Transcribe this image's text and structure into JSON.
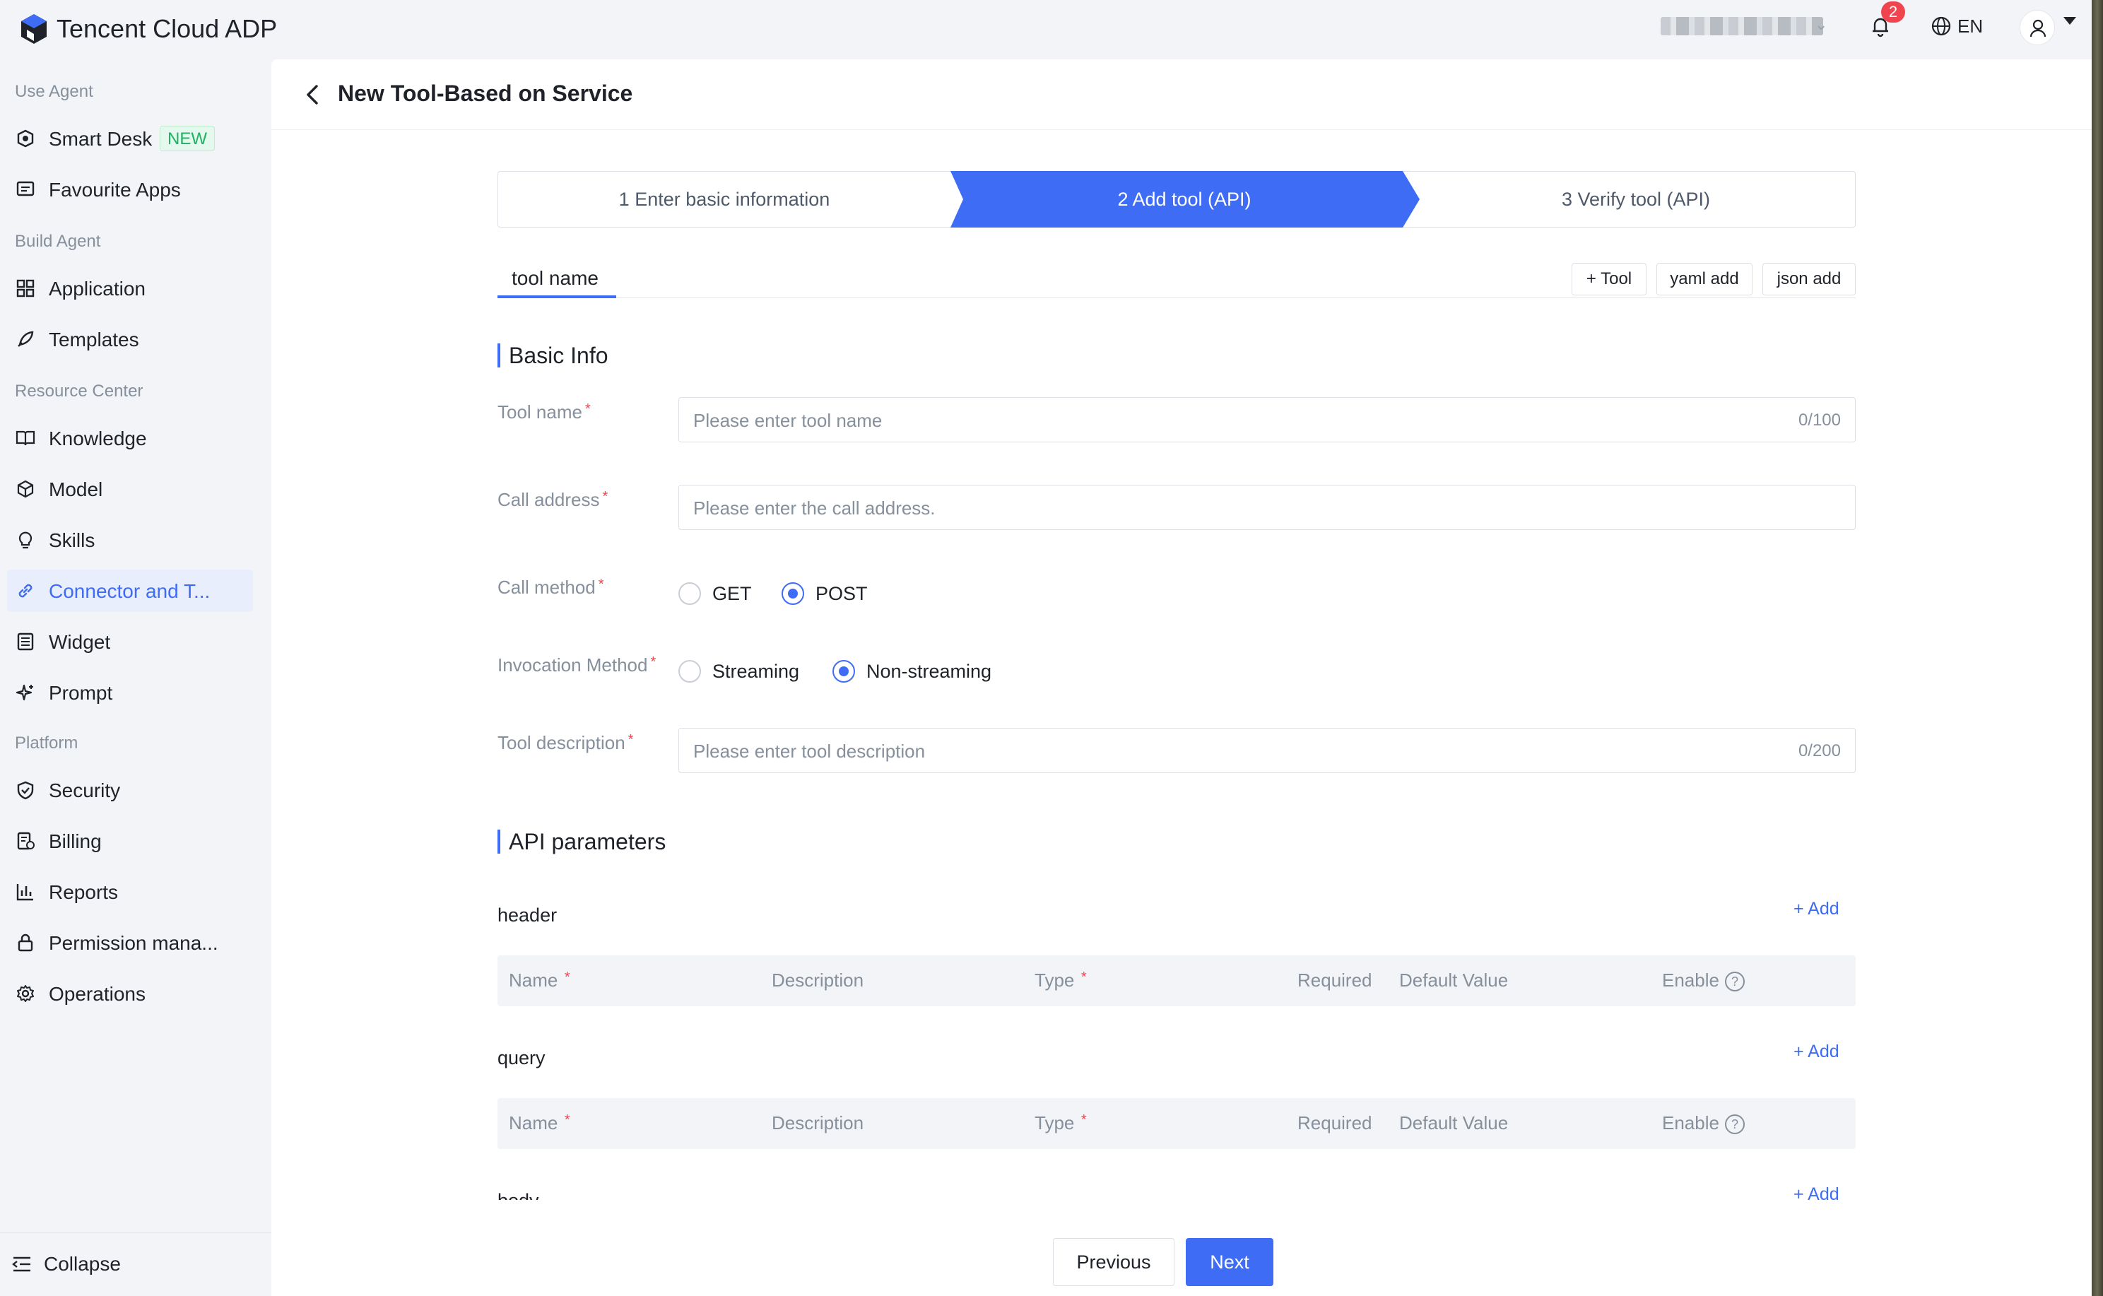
{
  "app": {
    "brand": "Tencent Cloud ADP",
    "notifications": "2",
    "lang": "EN"
  },
  "sidebar": {
    "sections": [
      {
        "title": "Use Agent"
      },
      {
        "title": "Build Agent"
      },
      {
        "title": "Resource Center"
      },
      {
        "title": "Platform"
      }
    ],
    "items": [
      {
        "label": "Smart Desk",
        "badge": "NEW",
        "icon": "smart-desk-icon"
      },
      {
        "label": "Favourite Apps",
        "icon": "favourite-icon"
      },
      {
        "label": "Application",
        "icon": "grid-icon"
      },
      {
        "label": "Templates",
        "icon": "rocket-icon"
      },
      {
        "label": "Knowledge",
        "icon": "book-icon"
      },
      {
        "label": "Model",
        "icon": "cube-icon"
      },
      {
        "label": "Skills",
        "icon": "bulb-icon"
      },
      {
        "label": "Connector and T...",
        "icon": "link-icon",
        "active": true
      },
      {
        "label": "Widget",
        "icon": "widget-icon"
      },
      {
        "label": "Prompt",
        "icon": "sparkle-icon"
      },
      {
        "label": "Security",
        "icon": "shield-icon"
      },
      {
        "label": "Billing",
        "icon": "bill-icon"
      },
      {
        "label": "Reports",
        "icon": "bar-chart-icon"
      },
      {
        "label": "Permission mana...",
        "icon": "lock-icon"
      },
      {
        "label": "Operations",
        "icon": "gear-icon"
      }
    ],
    "collapse": "Collapse"
  },
  "page": {
    "title": "New Tool-Based on Service"
  },
  "steps": [
    "1 Enter basic information",
    "2 Add tool (API)",
    "3 Verify tool (API)"
  ],
  "tabs": {
    "current": "tool name",
    "buttons": [
      "+ Tool",
      "yaml add",
      "json add"
    ]
  },
  "basic_info": {
    "heading": "Basic Info",
    "tool_name": {
      "label": "Tool name",
      "placeholder": "Please enter tool name",
      "count": "0/100"
    },
    "call_address": {
      "label": "Call address",
      "placeholder": "Please enter the call address."
    },
    "call_method": {
      "label": "Call method",
      "options": [
        "GET",
        "POST"
      ],
      "selected": "POST"
    },
    "invocation": {
      "label": "Invocation Method",
      "options": [
        "Streaming",
        "Non-streaming"
      ],
      "selected": "Non-streaming"
    },
    "description": {
      "label": "Tool description",
      "placeholder": "Please enter tool description",
      "count": "0/200"
    }
  },
  "api_params": {
    "heading": "API parameters",
    "add_label": "+ Add",
    "groups": [
      "header",
      "query",
      "body"
    ],
    "columns": [
      "Name",
      "Description",
      "Type",
      "Required",
      "Default Value",
      "Enable"
    ]
  },
  "footer": {
    "previous": "Previous",
    "next": "Next"
  },
  "colors": {
    "accent": "#3f6cf5",
    "required": "#f0454e",
    "badge_green": "#1fb264"
  }
}
